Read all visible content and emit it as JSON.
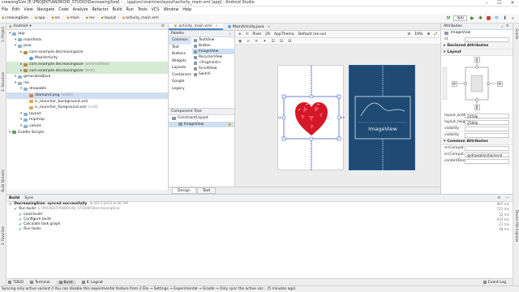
{
  "window": {
    "title": "creasingSize [E:\\PROJEKT\\ANDROID_STUDIO\\DecreasingSize] - ...\\app\\src\\main\\res\\layout\\activity_main.xml [app] - Android Studio",
    "controls": [
      "–",
      "☐",
      "✕"
    ]
  },
  "menu": [
    "File",
    "Edit",
    "View",
    "Navigate",
    "Code",
    "Analyze",
    "Refactor",
    "Build",
    "Run",
    "Tools",
    "VCS",
    "Window",
    "Help"
  ],
  "breadcrumb": [
    "creasingSize",
    "app",
    "src",
    "main",
    "res",
    "layout",
    "activity_main.xml"
  ],
  "toolbar": {
    "run_config": "app"
  },
  "left_strip_tabs": [
    "1: Project",
    "2: Structure",
    "Build Variants",
    "2: Favorites"
  ],
  "right_strip_tabs": [
    "Gradle",
    "Device File Explorer"
  ],
  "project": {
    "view_selector": "Android",
    "tree": [
      {
        "label": "app",
        "depth": 0,
        "kind": "folder",
        "extra": ""
      },
      {
        "label": "manifests",
        "depth": 1,
        "kind": "folder",
        "extra": ""
      },
      {
        "label": "java",
        "depth": 1,
        "kind": "folder",
        "extra": ""
      },
      {
        "label": "com.example.decreasingsize",
        "depth": 2,
        "kind": "pkg",
        "extra": ""
      },
      {
        "label": "MainActivity",
        "depth": 3,
        "kind": "kt",
        "extra": ""
      },
      {
        "label": "com.example.decreasingsize",
        "depth": 2,
        "kind": "pkg",
        "extra": "(androidTest)",
        "hl": true
      },
      {
        "label": "com.example.decreasingsize",
        "depth": 2,
        "kind": "pkg",
        "extra": "(test)",
        "hl": true
      },
      {
        "label": "generatedJava",
        "depth": 1,
        "kind": "folder",
        "extra": ""
      },
      {
        "label": "res",
        "depth": 1,
        "kind": "folder",
        "extra": ""
      },
      {
        "label": "drawable",
        "depth": 2,
        "kind": "folder",
        "extra": ""
      },
      {
        "label": "diamond.png",
        "depth": 3,
        "kind": "img",
        "extra": "(xxxh)",
        "sel": true
      },
      {
        "label": "ic_launcher_background.xml",
        "depth": 3,
        "kind": "xml",
        "extra": ""
      },
      {
        "label": "ic_launcher_foreground.xml",
        "depth": 3,
        "kind": "xml",
        "extra": "(v24)"
      },
      {
        "label": "layout",
        "depth": 2,
        "kind": "folder",
        "extra": ""
      },
      {
        "label": "mipmap",
        "depth": 2,
        "kind": "folder",
        "extra": ""
      },
      {
        "label": "values",
        "depth": 2,
        "kind": "folder",
        "extra": ""
      },
      {
        "label": "Gradle Scripts",
        "depth": 0,
        "kind": "gradle",
        "extra": ""
      }
    ]
  },
  "editor_tabs": [
    {
      "label": "activity_main.xml",
      "active": true
    },
    {
      "label": "MainActivity.java",
      "active": false
    }
  ],
  "palette": {
    "header": "Palette",
    "categories": [
      "Common",
      "Text",
      "Buttons",
      "Widgets",
      "Layouts",
      "Containers",
      "Google",
      "Legacy"
    ],
    "active_category": 0,
    "items": [
      "TextView",
      "Button",
      "ImageView",
      "RecyclerView",
      "<fragment>",
      "ScrollView",
      "Switch"
    ],
    "active_item": 2
  },
  "component_tree": {
    "header": "Component Tree",
    "nodes": [
      {
        "label": "ConstraintLayout",
        "depth": 0,
        "warn": false
      },
      {
        "label": "ImageView",
        "depth": 1,
        "warn": true
      }
    ]
  },
  "design_toolbar": {
    "device": "Pixel",
    "api": "29",
    "theme": "AppTheme",
    "locale": "Default (en-us)",
    "zoom": "19%"
  },
  "blueprint": {
    "label": "ImageView"
  },
  "design_tabs": [
    "Design",
    "Text"
  ],
  "attributes": {
    "header": "Attributes",
    "component": "ImageView",
    "id_label": "id",
    "id_value": "",
    "sections": {
      "declared": "Declared Attributes",
      "layout": "Layout",
      "common": "Common Attributes"
    },
    "constraint_values": {
      "top": "0",
      "left": "0",
      "right": "0",
      "bottom": "0"
    },
    "layout_rows": [
      {
        "k": "layout_width",
        "v": "245dp"
      },
      {
        "k": "layout_height",
        "v": "258dp"
      },
      {
        "k": "visibility",
        "v": ""
      },
      {
        "k": "visibility",
        "v": ""
      }
    ],
    "common_rows": [
      {
        "k": "srcCompat",
        "v": ""
      },
      {
        "k": "srcCompat",
        "v": "@drawable/diamond"
      },
      {
        "k": "contentDescription",
        "v": ""
      }
    ]
  },
  "build": {
    "header_tabs": [
      "Build",
      "Sync"
    ],
    "rows": [
      {
        "text": "DecreasingSize: synced successfully",
        "meta": "at 8/17/2019 8:46 PM",
        "depth": 0,
        "time": "987 ms"
      },
      {
        "text": "Run build",
        "meta": "E:\\PROJEKT\\ANDROID_STUDIO\\DecreasingSize",
        "depth": 1,
        "time": "721 ms"
      },
      {
        "text": "Load build",
        "meta": "",
        "depth": 2,
        "time": "12 ms"
      },
      {
        "text": "Configure build",
        "meta": "",
        "depth": 2,
        "time": "433 ms"
      },
      {
        "text": "Calculate task graph",
        "meta": "",
        "depth": 2,
        "time": "21 ms"
      },
      {
        "text": "Run tasks",
        "meta": "",
        "depth": 2,
        "time": "48 ms"
      }
    ]
  },
  "bottom_tabs": [
    "TODO",
    "Terminal",
    "Build",
    "6: Logcat"
  ],
  "active_bottom_tab": 2,
  "event_log": "Event Log",
  "status": "Syncing only active variant // You can disable this experimental feature from // File → Settings → Experimental → Gradle → Only sync the active var... (5 minutes ago)"
}
